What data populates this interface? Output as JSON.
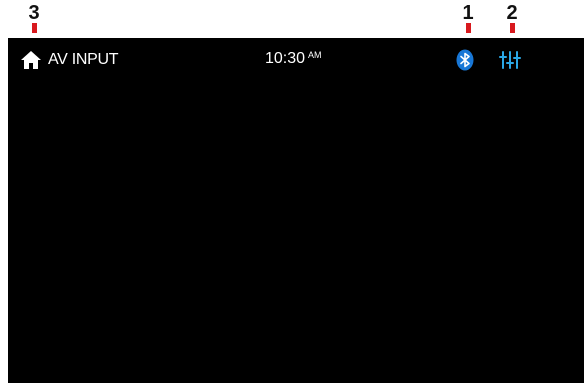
{
  "callouts": {
    "home": "3",
    "bluetooth": "1",
    "equalizer": "2"
  },
  "status_bar": {
    "source": "AV INPUT",
    "time": "10:30",
    "ampm": "AM",
    "icons": {
      "home": "home-icon",
      "bluetooth": "bluetooth-icon",
      "equalizer": "equalizer-icon"
    }
  },
  "colors": {
    "screen_bg": "#000000",
    "bluetooth": "#1877d6",
    "equalizer": "#2aa8e6",
    "callout_tick": "#d8191e"
  }
}
